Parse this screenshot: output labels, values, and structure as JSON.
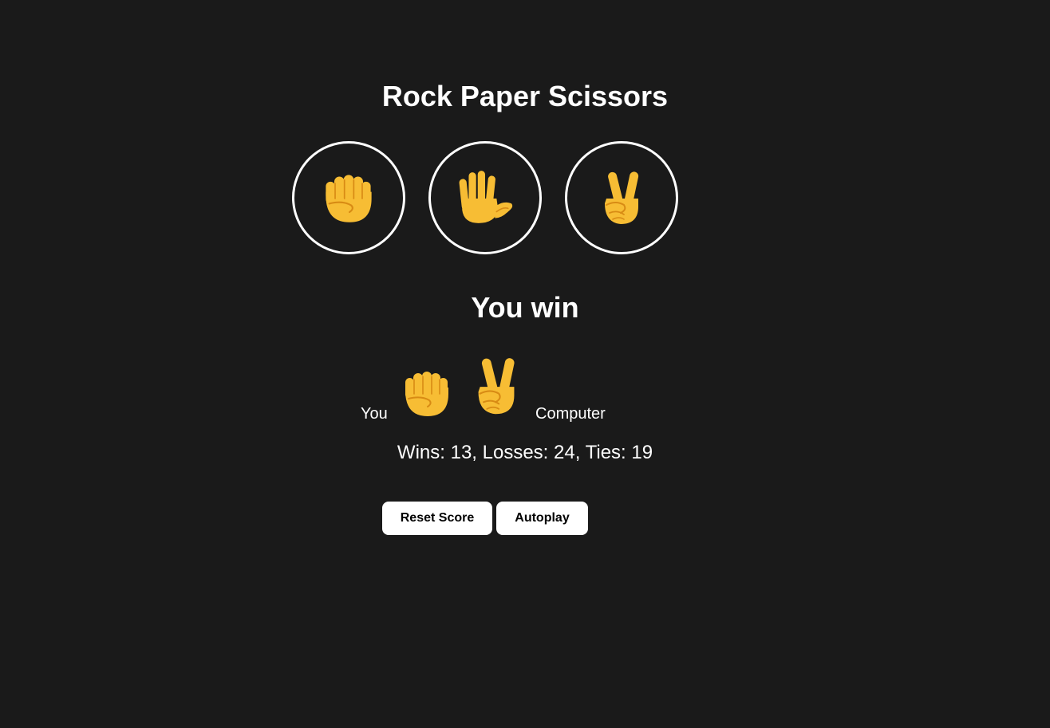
{
  "title": "Rock Paper Scissors",
  "moves": [
    {
      "name": "rock",
      "icon": "raised-fist-icon"
    },
    {
      "name": "paper",
      "icon": "raised-hand-icon"
    },
    {
      "name": "scissors",
      "icon": "victory-hand-icon"
    }
  ],
  "result": "You win",
  "last_round": {
    "you_label": "You",
    "you_move_icon": "raised-fist-icon",
    "computer_move_icon": "victory-hand-icon",
    "computer_label": "Computer"
  },
  "score_text": "Wins: 13, Losses: 24, Ties: 19",
  "buttons": {
    "reset": "Reset Score",
    "autoplay": "Autoplay"
  },
  "colors": {
    "background": "#1a1a1a",
    "text": "#ffffff",
    "emoji": "#f7bd34",
    "emoji_line": "#d88b14"
  }
}
